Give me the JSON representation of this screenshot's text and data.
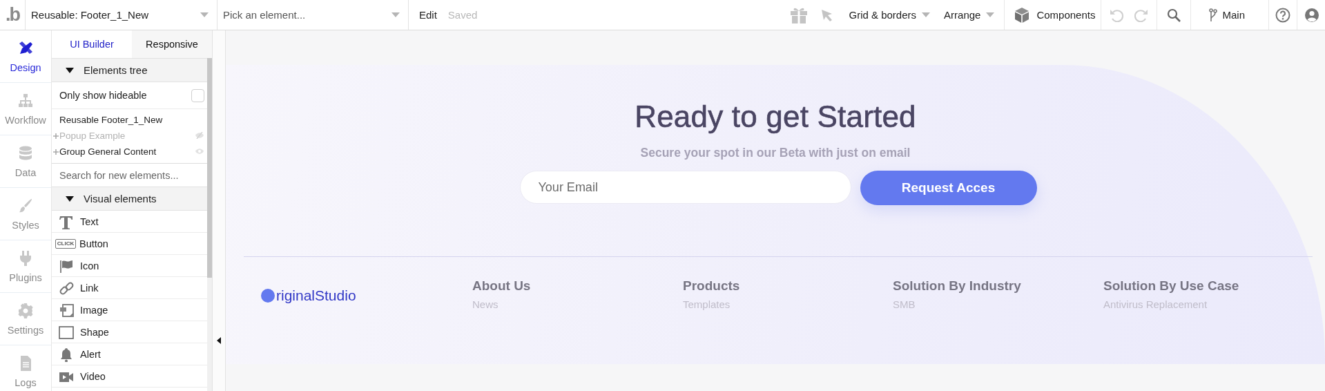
{
  "toolbar": {
    "logo": ".b",
    "page_selector": "Reusable: Footer_1_New",
    "element_picker": {
      "placeholder": "Pick an element..."
    },
    "edit": "Edit",
    "save_status": "Saved",
    "grid_borders": "Grid & borders",
    "arrange": "Arrange",
    "components": "Components",
    "branch": "Main"
  },
  "sidebar": {
    "items": [
      {
        "label": "Design",
        "selected": true
      },
      {
        "label": "Workflow",
        "selected": false
      },
      {
        "label": "Data",
        "selected": false
      },
      {
        "label": "Styles",
        "selected": false
      },
      {
        "label": "Plugins",
        "selected": false
      },
      {
        "label": "Settings",
        "selected": false
      },
      {
        "label": "Logs",
        "selected": false
      }
    ]
  },
  "panel": {
    "tabs": [
      {
        "label": "UI Builder",
        "selected": true
      },
      {
        "label": "Responsive",
        "selected": false
      }
    ],
    "elements_tree": {
      "title": "Elements tree",
      "expanded": true,
      "only_show_hideable": {
        "label": "Only show hideable",
        "checked": false
      },
      "items": [
        {
          "label": "Reusable Footer_1_New",
          "expandable": false
        },
        {
          "label": "Popup Example",
          "expandable": true,
          "hidden": true
        },
        {
          "label": "Group General Content",
          "expandable": true,
          "hidden": false
        }
      ]
    },
    "search": {
      "placeholder": "Search for new elements..."
    },
    "visual_elements": {
      "title": "Visual elements",
      "expanded": true,
      "items": [
        {
          "label": "Text"
        },
        {
          "label": "Button",
          "icon_text": "CLICK"
        },
        {
          "label": "Icon"
        },
        {
          "label": "Link"
        },
        {
          "label": "Image"
        },
        {
          "label": "Shape"
        },
        {
          "label": "Alert"
        },
        {
          "label": "Video"
        }
      ]
    }
  },
  "canvas": {
    "heading": "Ready to get Started",
    "subheading": "Secure your spot in our Beta with just on email",
    "email_field": {
      "placeholder": "Your Email"
    },
    "cta_button": "Request Acces",
    "brand": "riginalStudio",
    "footer_columns": [
      {
        "heading": "About Us",
        "link": "News"
      },
      {
        "heading": "Products",
        "link": "Templates"
      },
      {
        "heading": "Solution By Industry",
        "link": "SMB"
      },
      {
        "heading": "Solution By Use Case",
        "link": "Antivirus Replacement"
      }
    ]
  }
}
